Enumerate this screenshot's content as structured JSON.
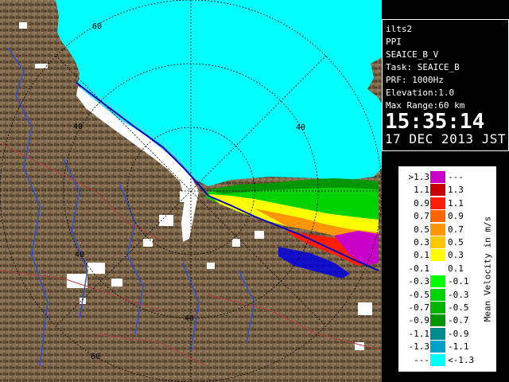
{
  "info": {
    "site": "ilts2",
    "mode": "PPI",
    "product": "SEAICE_B_V",
    "task": "Task: SEAICE_B",
    "prf": "PRF: 1000Hz",
    "elevation": "Elevation:1.0",
    "max_range": "Max Range:60 km",
    "time": "15:35:14",
    "date": "17 DEC 2013 JST"
  },
  "legend": {
    "title": "Mean Velocity in m/s",
    "rows": [
      {
        "left": ">1.3",
        "right": "---",
        "color": "#c800c8"
      },
      {
        "left": "1.1",
        "right": "1.3",
        "color": "#c80000"
      },
      {
        "left": "0.9",
        "right": "1.1",
        "color": "#ff1e00"
      },
      {
        "left": "0.7",
        "right": "0.9",
        "color": "#ff6400"
      },
      {
        "left": "0.5",
        "right": "0.7",
        "color": "#ff9600"
      },
      {
        "left": "0.3",
        "right": "0.5",
        "color": "#ffc800"
      },
      {
        "left": "0.1",
        "right": "0.3",
        "color": "#ffff00"
      },
      {
        "left": "-0.1",
        "right": "0.1",
        "color": "#ffffff"
      },
      {
        "left": "-0.3",
        "right": "-0.1",
        "color": "#00ff00"
      },
      {
        "left": "-0.5",
        "right": "-0.3",
        "color": "#00d200"
      },
      {
        "left": "-0.7",
        "right": "-0.5",
        "color": "#00b400"
      },
      {
        "left": "-0.9",
        "right": "-0.7",
        "color": "#009600"
      },
      {
        "left": "-1.1",
        "right": "-0.9",
        "color": "#008c8c"
      },
      {
        "left": "-1.3",
        "right": "-1.1",
        "color": "#00a0c8"
      },
      {
        "left": "---",
        "right": "<-1.3",
        "color": "#00ffff"
      }
    ]
  },
  "radar": {
    "range_labels": [
      "60",
      "40",
      "40",
      "40",
      "40",
      "60"
    ],
    "colors": {
      "land": "#7a6448",
      "sea_ice": "#00ffff",
      "ice_edge": "#00e0ff",
      "coast_line": "#0000c0",
      "river": "#3050d0",
      "road": "#b04040",
      "ring": "#000000",
      "clutter": "#ffffff"
    }
  }
}
